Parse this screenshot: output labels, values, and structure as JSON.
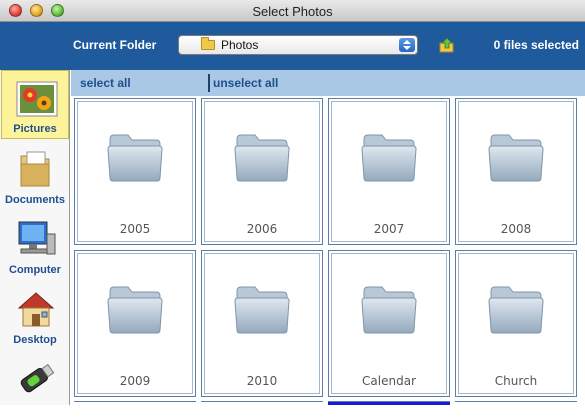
{
  "window": {
    "title": "Select Photos"
  },
  "toolbar": {
    "current_folder_label": "Current Folder",
    "folder_value": "Photos",
    "files_selected": "0 files selected"
  },
  "sidebar": {
    "items": [
      {
        "label": "Pictures",
        "icon": "pictures-icon",
        "active": true
      },
      {
        "label": "Documents",
        "icon": "documents-icon"
      },
      {
        "label": "Computer",
        "icon": "computer-icon"
      },
      {
        "label": "Desktop",
        "icon": "desktop-icon"
      },
      {
        "label": "",
        "icon": "usb-drive-icon"
      }
    ]
  },
  "actions": {
    "select_all": "select all",
    "unselect_all": "unselect all"
  },
  "folders": [
    "2005",
    "2006",
    "2007",
    "2008",
    "2009",
    "2010",
    "Calendar",
    "Church"
  ],
  "colors": {
    "toolbar_bg": "#1f5a9c",
    "action_bar_bg": "#a8c8e6",
    "active_item_bg": "#fdf39a",
    "label_blue": "#1f4f8c"
  }
}
